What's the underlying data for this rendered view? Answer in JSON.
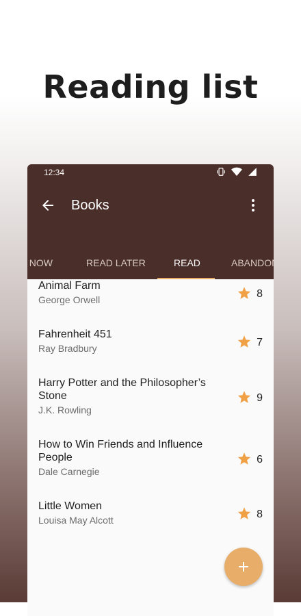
{
  "headline": "Reading list",
  "status": {
    "time": "12:34"
  },
  "appbar": {
    "title": "Books"
  },
  "tabs": [
    {
      "label": "G NOW"
    },
    {
      "label": "READ LATER"
    },
    {
      "label": "READ"
    },
    {
      "label": "ABANDON"
    }
  ],
  "books": [
    {
      "title": "Animal Farm",
      "author": "George Orwell",
      "rating": "8"
    },
    {
      "title": "Fahrenheit 451",
      "author": "Ray Bradbury",
      "rating": "7"
    },
    {
      "title": "Harry Potter and the Philosopher’s Stone",
      "author": "J.K. Rowling",
      "rating": "9"
    },
    {
      "title": "How to Win Friends and Influence People",
      "author": "Dale Carnegie",
      "rating": "6"
    },
    {
      "title": "Little Women",
      "author": "Louisa May Alcott",
      "rating": "8"
    }
  ],
  "colors": {
    "primary": "#4a2e29",
    "accent": "#e8ad69",
    "star": "#f0a045"
  },
  "icons": {
    "back": "arrow-back-icon",
    "more": "more-vert-icon",
    "star": "star-icon",
    "fab": "add-icon"
  }
}
